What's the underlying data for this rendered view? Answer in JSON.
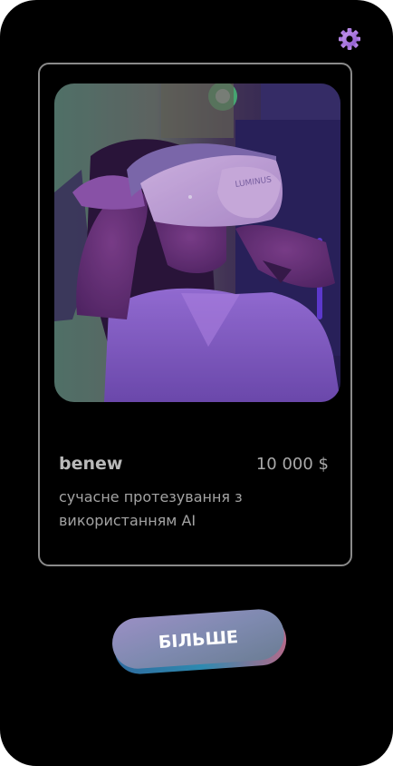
{
  "card": {
    "brand": "benew",
    "price": "10 000 $",
    "description": "сучасне протезування з використанням AI",
    "headset_text": "LUMINUS"
  },
  "cta": {
    "label": "БІЛЬШЕ"
  },
  "icons": {
    "settings": "gear-icon"
  },
  "colors": {
    "accent": "#a774e0",
    "background": "#000000",
    "button_top": "#8e8eb5"
  }
}
